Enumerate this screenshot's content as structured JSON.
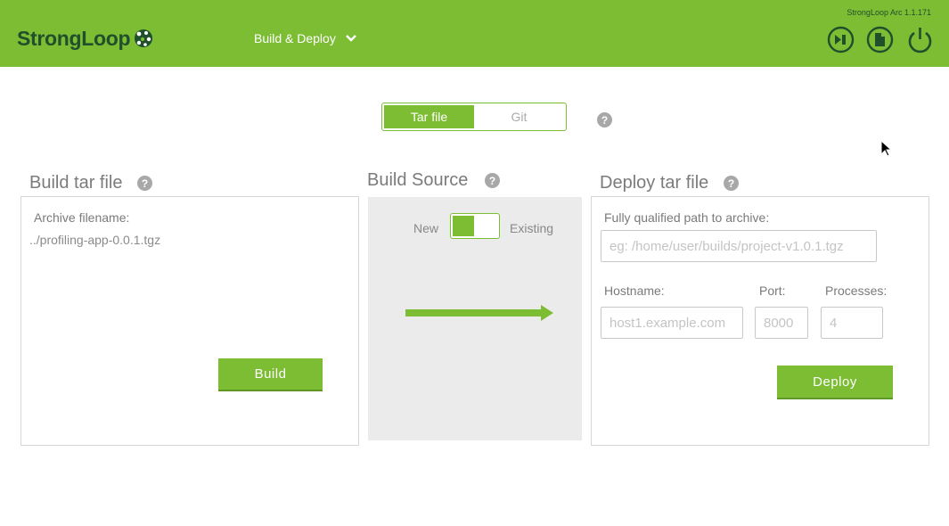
{
  "header": {
    "logo_text": "StrongLoop",
    "nav_title": "Build & Deploy",
    "version": "StrongLoop Arc 1.1.171",
    "icons": [
      "run-icon",
      "document-icon",
      "power-icon"
    ]
  },
  "mode_tabs": [
    {
      "label": "Tar file",
      "active": true
    },
    {
      "label": "Git",
      "active": false
    }
  ],
  "build": {
    "title": "Build tar file",
    "archive_label": "Archive filename:",
    "archive_value": "../profiling-app-0.0.1.tgz",
    "button_label": "Build"
  },
  "source": {
    "title": "Build Source",
    "toggle_left": "New",
    "toggle_right": "Existing"
  },
  "deploy": {
    "title": "Deploy tar file",
    "path_label": "Fully qualified path to archive:",
    "path_placeholder": "eg: /home/user/builds/project-v1.0.1.tgz",
    "hostname_label": "Hostname:",
    "hostname_placeholder": "host1.example.com",
    "port_label": "Port:",
    "port_placeholder": "8000",
    "processes_label": "Processes:",
    "processes_placeholder": "4",
    "button_label": "Deploy"
  },
  "colors": {
    "brand_green": "#7cbd34",
    "logo_dark": "#1f4f2b"
  }
}
